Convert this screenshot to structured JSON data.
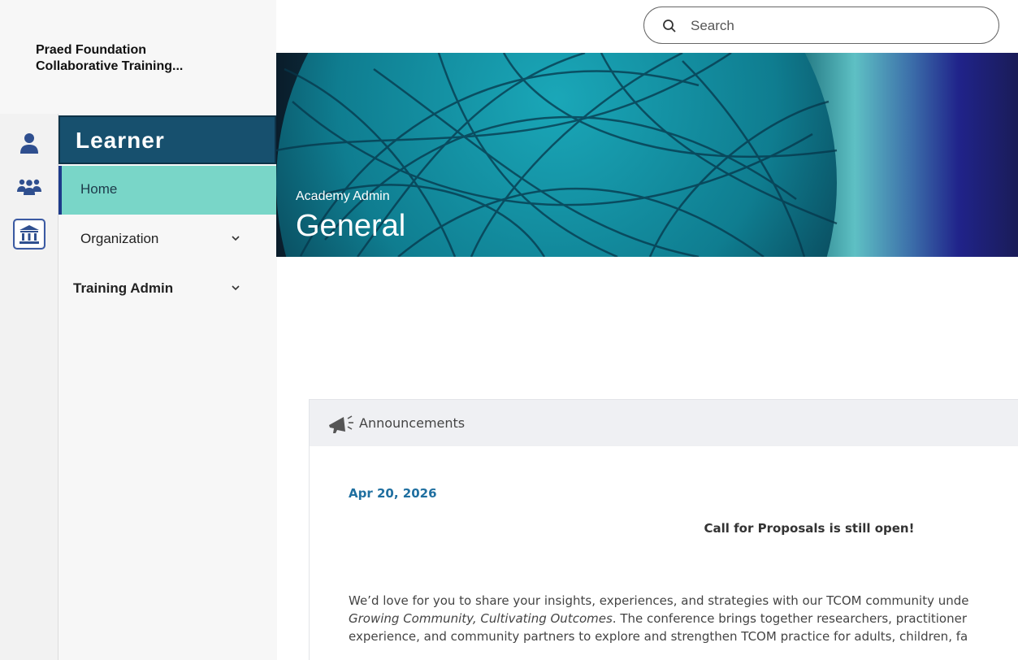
{
  "org": {
    "name_line1": "Praed Foundation",
    "name_line2": "Collaborative Training..."
  },
  "rail": {
    "icons": [
      {
        "name": "person-icon",
        "color": "#2f4f8f"
      },
      {
        "name": "group-icon",
        "color": "#2f4f8f"
      },
      {
        "name": "institution-icon",
        "color": "#2f4f8f"
      }
    ]
  },
  "sidebar": {
    "section_title": "Learner",
    "items": [
      {
        "label": "Home",
        "active": true
      },
      {
        "label": "Organization",
        "has_children": true
      },
      {
        "label": "Training Admin",
        "has_children": true
      }
    ]
  },
  "search": {
    "placeholder": "Search"
  },
  "banner": {
    "subtitle": "Academy Admin",
    "title": "General"
  },
  "announcements": {
    "title": "Announcements",
    "date": "Apr 20, 2026",
    "heading": "Call for Proposals is still open!",
    "body": {
      "line1": "We’d love for you to share your insights, experiences, and strategies with our TCOM community unde",
      "line2_italic": "Growing Community, Cultivating Outcomes",
      "line2_rest": ". The conference brings together researchers, practitioner",
      "line3": "experience, and community partners to explore and strengthen TCOM practice for adults, children, fa"
    }
  },
  "colors": {
    "section_bg": "#17506e",
    "home_bg": "#79d6c8",
    "date_link": "#1f6fa0"
  }
}
